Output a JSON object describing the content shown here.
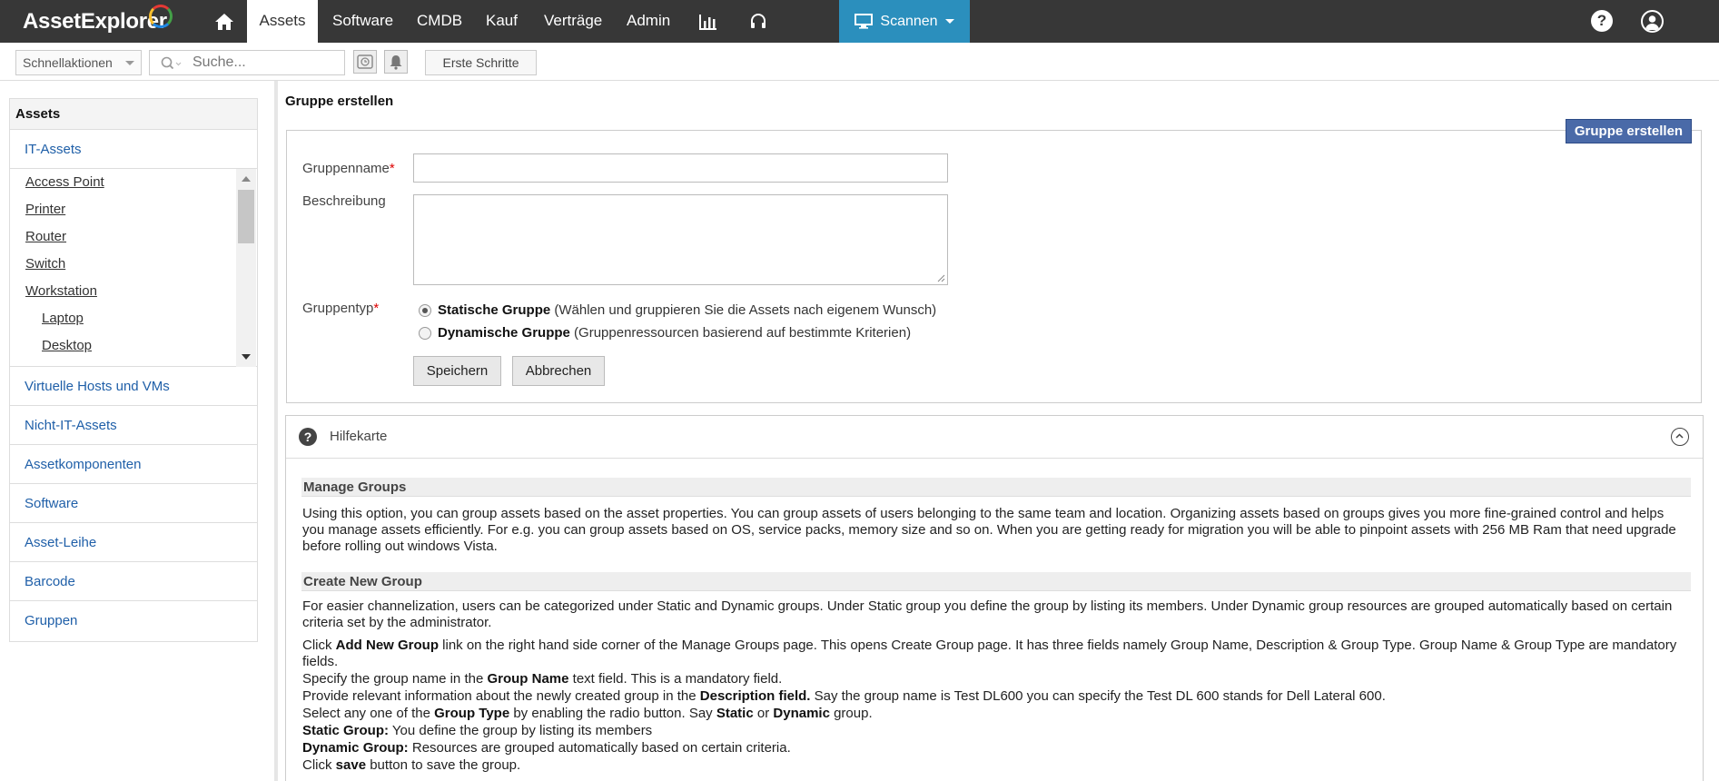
{
  "app": {
    "logo": "AssetExplorer"
  },
  "nav": {
    "tabs": [
      {
        "label": "Assets"
      },
      {
        "label": "Software"
      },
      {
        "label": "CMDB"
      },
      {
        "label": "Kauf"
      },
      {
        "label": "Verträge"
      },
      {
        "label": "Admin"
      }
    ],
    "scan_label": "Scannen",
    "help_label": "?"
  },
  "toolbar": {
    "quick_actions": "Schnellaktionen",
    "search_placeholder": "Suche...",
    "getting_started": "Erste Schritte"
  },
  "sidebar": {
    "heading": "Assets",
    "it_assets": "IT-Assets",
    "items": [
      {
        "label": "Access Point"
      },
      {
        "label": "Printer"
      },
      {
        "label": "Router"
      },
      {
        "label": "Switch"
      },
      {
        "label": "Workstation"
      },
      {
        "label": "Laptop"
      },
      {
        "label": "Desktop"
      }
    ],
    "nav": [
      {
        "label": "Virtuelle Hosts und VMs"
      },
      {
        "label": "Nicht-IT-Assets"
      },
      {
        "label": "Assetkomponenten"
      },
      {
        "label": "Software"
      },
      {
        "label": "Asset-Leihe"
      },
      {
        "label": "Barcode"
      },
      {
        "label": "Gruppen"
      }
    ]
  },
  "main": {
    "title": "Gruppe erstellen",
    "create_button": "Gruppe erstellen",
    "form": {
      "name_label": "Gruppenname",
      "desc_label": "Beschreibung",
      "type_label": "Gruppentyp",
      "required_mark": "*",
      "name_value": "",
      "desc_value": "",
      "static_title": "Statische Gruppe",
      "static_desc": " (Wählen und gruppieren Sie die Assets nach eigenem Wunsch)",
      "dynamic_title": "Dynamische Gruppe",
      "dynamic_desc": " (Gruppenressourcen basierend auf bestimmte Kriterien)",
      "save": "Speichern",
      "cancel": "Abbrechen"
    },
    "help": {
      "icon": "?",
      "title": "Hilfekarte",
      "sec1_title": "Manage Groups",
      "sec1_text": "Using this option, you can group assets based on the asset properties. You can group assets of users belonging to the same team and location. Organizing assets based on groups gives you more fine-grained control and helps you manage assets efficiently. For e.g. you can group assets based on OS, service packs, memory size and so on. When you are getting ready for migration you will be able to pinpoint assets with 256 MB Ram that need upgrade before rolling out windows Vista.",
      "sec2_title": "Create New Group",
      "sec2_text": "For easier channelization, users can be categorized under Static and Dynamic groups. Under Static group you define the group by listing its members. Under Dynamic group resources are grouped automatically based on certain criteria set by the administrator.",
      "l1_a": "Click ",
      "l1_b": "Add New Group",
      "l1_c": " link on the right hand side corner of the Manage Groups page. This opens Create Group page. It has three fields namely Group Name, Description & Group Type. Group Name & Group Type are mandatory fields.",
      "l2_a": "Specify the group name in the ",
      "l2_b": "Group Name",
      "l2_c": " text field. This is a mandatory field.",
      "l3_a": "Provide relevant information about the newly created group in the ",
      "l3_b": "Description",
      "l3_c": " field.",
      "l3_d": " Say the group name is Test DL600 you can specify the Test DL 600 stands for Dell Lateral 600.",
      "l4_a": "Select any one of the ",
      "l4_b": "Group Type",
      "l4_c": " by enabling the radio button. Say ",
      "l4_d": "Static",
      "l4_e": " or ",
      "l4_f": "Dynamic",
      "l4_g": " group.",
      "l5_a": "Static Group:",
      "l5_b": " You define the group by listing its members",
      "l6_a": "Dynamic Group:",
      "l6_b": " Resources are grouped automatically based on certain criteria.",
      "l7_a": "Click ",
      "l7_b": "save",
      "l7_c": " button to save the group."
    }
  }
}
